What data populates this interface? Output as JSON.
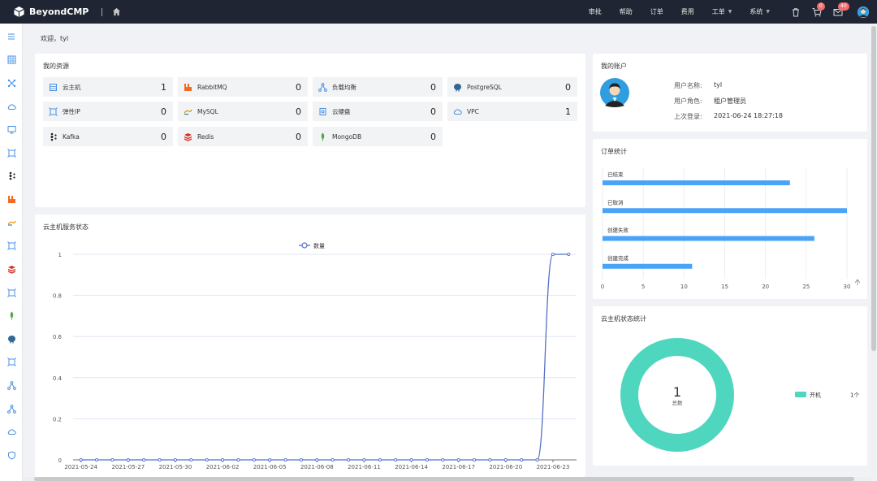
{
  "header": {
    "app_name": "BeyondCMP",
    "nav": [
      {
        "label": "审批",
        "icon": ""
      },
      {
        "label": "帮助",
        "icon": ""
      },
      {
        "label": "订单",
        "icon": ""
      },
      {
        "label": "费用",
        "icon": ""
      },
      {
        "label": "工单",
        "icon": "chevron-down-icon"
      },
      {
        "label": "系统",
        "icon": "chevron-down-icon"
      }
    ],
    "trash_badge": "",
    "cart_badge": "0",
    "mail_badge": "40"
  },
  "welcome": "欢迎，tyl",
  "resources": {
    "title": "我的资源",
    "items": [
      {
        "name": "云主机",
        "count": "1",
        "icon": "server-icon",
        "color": "#4a90e2"
      },
      {
        "name": "RabbitMQ",
        "count": "0",
        "icon": "rabbitmq-icon",
        "color": "#f26b22"
      },
      {
        "name": "负载均衡",
        "count": "0",
        "icon": "load-balancer-icon",
        "color": "#4a90e2"
      },
      {
        "name": "PostgreSQL",
        "count": "0",
        "icon": "postgresql-icon",
        "color": "#336791"
      },
      {
        "name": "弹性IP",
        "count": "0",
        "icon": "elastic-ip-icon",
        "color": "#4a90e2"
      },
      {
        "name": "MySQL",
        "count": "0",
        "icon": "mysql-icon",
        "color": "#e48e00"
      },
      {
        "name": "云硬盘",
        "count": "0",
        "icon": "disk-icon",
        "color": "#4a90e2"
      },
      {
        "name": "VPC",
        "count": "1",
        "icon": "cloud-icon",
        "color": "#4a90e2"
      },
      {
        "name": "Kafka",
        "count": "0",
        "icon": "kafka-icon",
        "color": "#222222"
      },
      {
        "name": "Redis",
        "count": "0",
        "icon": "redis-icon",
        "color": "#d82c20"
      },
      {
        "name": "MongoDB",
        "count": "0",
        "icon": "mongodb-icon",
        "color": "#4faa41"
      }
    ]
  },
  "account": {
    "title": "我的账户",
    "rows": [
      {
        "label": "用户名称:",
        "value": "tyl"
      },
      {
        "label": "用户角色:",
        "value": "租户管理员"
      },
      {
        "label": "上次登录:",
        "value": "2021-06-24 18:27:18"
      }
    ]
  },
  "vm_status_chart": {
    "title": "云主机服务状态",
    "chart_data": {
      "type": "line",
      "title": "",
      "legend": "top-center",
      "series": [
        {
          "name": "数量",
          "color": "#5470c6"
        }
      ],
      "x": [
        "2021-05-24",
        "2021-05-25",
        "2021-05-26",
        "2021-05-27",
        "2021-05-28",
        "2021-05-29",
        "2021-05-30",
        "2021-05-31",
        "2021-06-01",
        "2021-06-02",
        "2021-06-03",
        "2021-06-04",
        "2021-06-05",
        "2021-06-06",
        "2021-06-07",
        "2021-06-08",
        "2021-06-09",
        "2021-06-10",
        "2021-06-11",
        "2021-06-12",
        "2021-06-13",
        "2021-06-14",
        "2021-06-15",
        "2021-06-16",
        "2021-06-17",
        "2021-06-18",
        "2021-06-19",
        "2021-06-20",
        "2021-06-21",
        "2021-06-22",
        "2021-06-23",
        "2021-06-24"
      ],
      "values": [
        0,
        0,
        0,
        0,
        0,
        0,
        0,
        0,
        0,
        0,
        0,
        0,
        0,
        0,
        0,
        0,
        0,
        0,
        0,
        0,
        0,
        0,
        0,
        0,
        0,
        0,
        0,
        0,
        0,
        0,
        1,
        1
      ],
      "xticks": [
        "2021-05-24",
        "2021-05-27",
        "2021-05-30",
        "2021-06-02",
        "2021-06-05",
        "2021-06-08",
        "2021-06-11",
        "2021-06-14",
        "2021-06-17",
        "2021-06-20",
        "2021-06-23"
      ],
      "yticks": [
        "0",
        "0.2",
        "0.4",
        "0.6",
        "0.8",
        "1"
      ],
      "ylim": [
        0,
        1
      ],
      "grid": true
    }
  },
  "order_chart": {
    "title": "订单统计",
    "chart_data": {
      "type": "bar",
      "orientation": "horizontal",
      "categories": [
        "已结束",
        "已取消",
        "创建失败",
        "创建完成"
      ],
      "values": [
        23,
        30,
        26,
        11
      ],
      "xticks": [
        "0",
        "5",
        "10",
        "15",
        "20",
        "25",
        "30"
      ],
      "xlim": [
        0,
        30
      ],
      "color": "#4ba3f8",
      "grid": true
    }
  },
  "vm_state_chart": {
    "title": "云主机状态统计",
    "chart_data": {
      "type": "pie",
      "center_value": "1",
      "center_label": "总数",
      "slices": [
        {
          "name": "开机",
          "value": 1,
          "display": "1个",
          "color": "#4fd6bf"
        }
      ],
      "legend": "right"
    }
  }
}
